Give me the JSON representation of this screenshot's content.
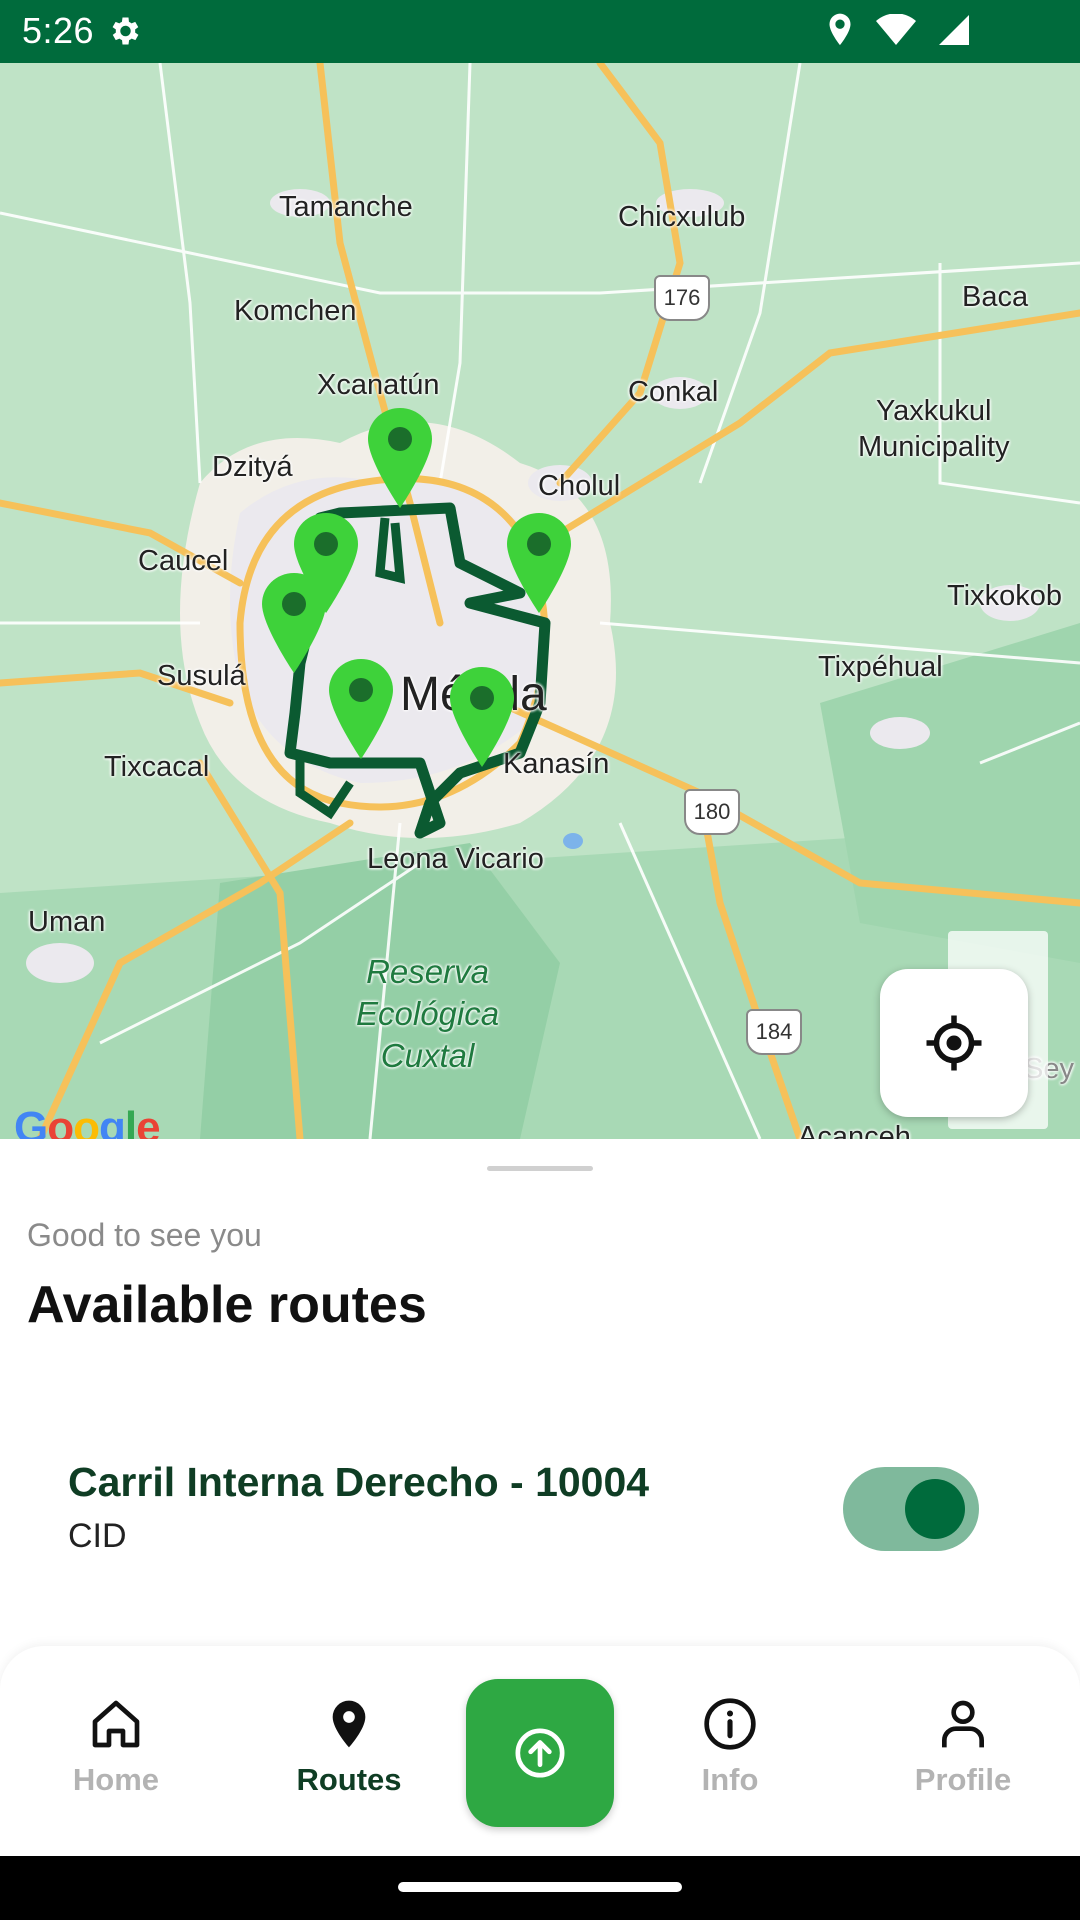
{
  "status_bar": {
    "time": "5:26",
    "icons": [
      "gear-icon",
      "location-icon",
      "wifi-icon",
      "signal-icon"
    ]
  },
  "map": {
    "labels": {
      "tamanche": "Tamanche",
      "chicxulub": "Chicxulub",
      "komchen": "Komchen",
      "baca": "Baca",
      "xcanatun": "Xcanatún",
      "conkal": "Conkal",
      "yaxkukul_line1": "Yaxkukul",
      "yaxkukul_line2": "Municipality",
      "dzitya": "Dzityá",
      "cholul": "Cholul",
      "caucel": "Caucel",
      "tixkokob": "Tixkokob",
      "susula": "Susulá",
      "merida": "Mérida",
      "tixpehual": "Tixpéhual",
      "tixcacal": "Tixcacal",
      "kanasin": "Kanasín",
      "leona_vicario": "Leona Vicario",
      "uman": "Uman",
      "reserva_line1": "Reserva",
      "reserva_line2": "Ecológica",
      "reserva_line3": "Cuxtal",
      "sey": "Sey",
      "acanceh": "Acanceh"
    },
    "road_shields": {
      "r176": "176",
      "r180": "180",
      "r184": "184"
    },
    "logo": "Google",
    "colors": {
      "land": "#bfe3c6",
      "urban": "#ecebee",
      "highway": "#f6c15a",
      "route": "#0b5a31",
      "pin": "#3ed23a"
    }
  },
  "sheet": {
    "greeting": "Good to see you",
    "title": "Available routes",
    "routes": [
      {
        "name": "Carril Interna Derecho - 10004",
        "code": "CID",
        "enabled": true
      }
    ]
  },
  "nav": {
    "home": "Home",
    "routes": "Routes",
    "info": "Info",
    "profile": "Profile",
    "active": "Routes"
  }
}
